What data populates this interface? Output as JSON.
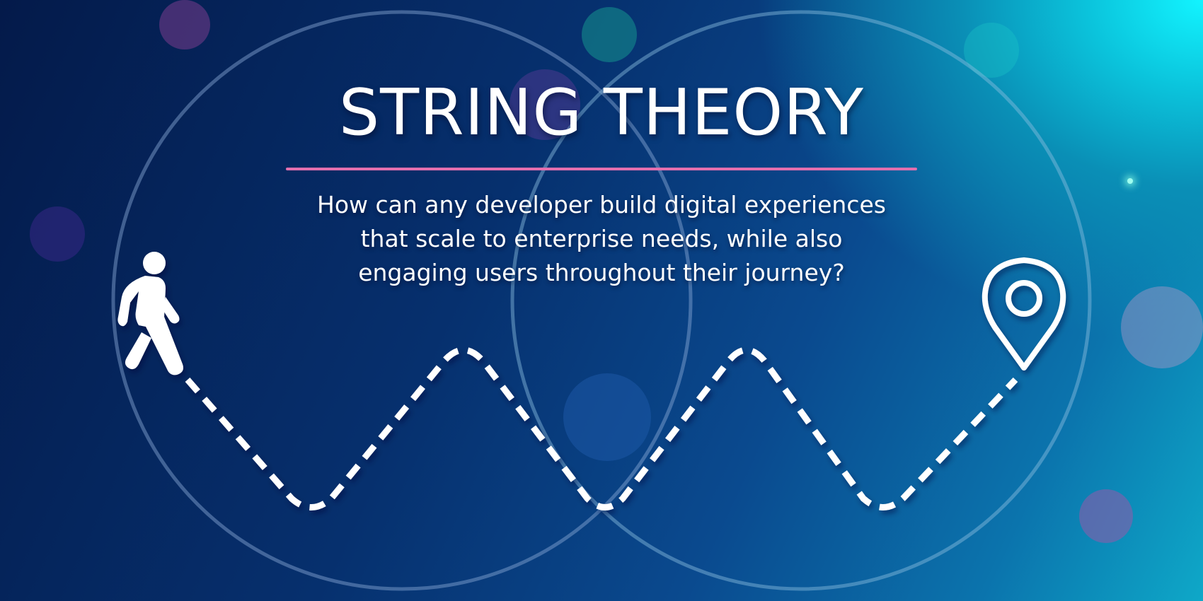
{
  "title": "STRING THEORY",
  "subtitle_lines": [
    "How can any developer build digital experiences",
    "that scale to enterprise needs, while also",
    "engaging users throughout their journey?"
  ],
  "icons": {
    "start": "walking-person-icon",
    "end": "map-pin-icon"
  },
  "colors": {
    "accent_rule": "#e26fae",
    "text": "#ffffff",
    "path": "#ffffff",
    "ring": "#5a86b8",
    "background_dark": "#041a4a",
    "background_light": "#12f4ff"
  }
}
